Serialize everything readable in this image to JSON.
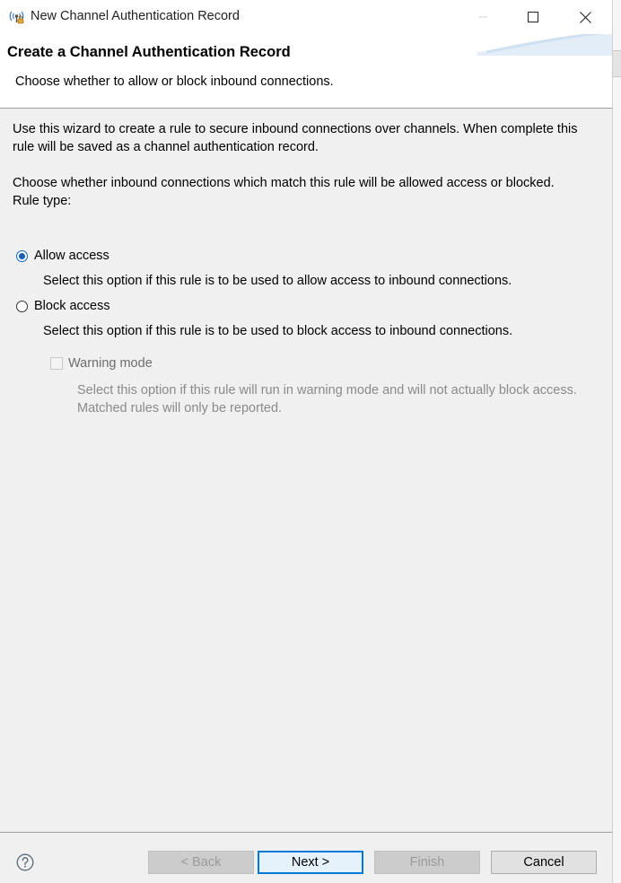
{
  "window": {
    "title": "New Channel Authentication Record",
    "controls": [
      "minimize-icon",
      "maximize-icon",
      "close-icon"
    ]
  },
  "header": {
    "title": "Create a Channel Authentication Record",
    "subtitle": "Choose whether to allow or block inbound connections."
  },
  "content": {
    "intro": "Use this wizard to create a rule to secure inbound connections over channels. When complete this rule will be saved as a channel authentication record.",
    "question": "Choose whether inbound connections which match this rule will be allowed access or blocked.",
    "rule_type_label": "Rule type:",
    "options": [
      {
        "label": "Allow access",
        "description": "Select this option if this rule is to be used to allow access to inbound connections.",
        "selected": true
      },
      {
        "label": "Block access",
        "description": "Select this option if this rule is to be used to block access to inbound connections.",
        "selected": false
      }
    ],
    "warning_mode": {
      "label": "Warning mode",
      "description": "Select this option if this rule will run in warning mode and will not actually block access. Matched rules will only be reported.",
      "checked": false,
      "enabled": false
    }
  },
  "footer": {
    "help_icon": "help-icon",
    "back_label": "< Back",
    "next_label": "Next >",
    "finish_label": "Finish",
    "cancel_label": "Cancel"
  },
  "colors": {
    "accent": "#0078d7",
    "background": "#f0f0f0",
    "disabled_text": "#8a8a8a"
  }
}
